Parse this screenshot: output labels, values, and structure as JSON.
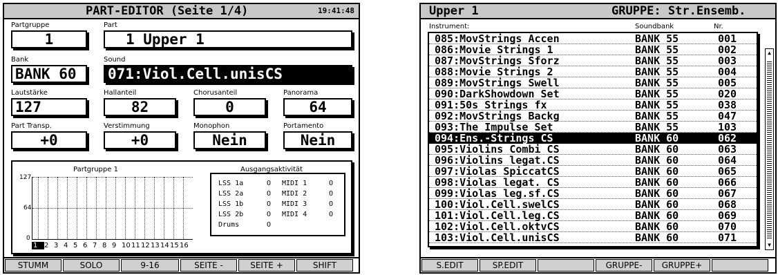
{
  "left": {
    "title": "PART-EDITOR (Seite 1/4)",
    "clock": "19:41:48",
    "partgruppe": {
      "label": "Partgruppe",
      "value": "1"
    },
    "part": {
      "label": "Part",
      "value": "1  Upper 1"
    },
    "bank": {
      "label": "Bank",
      "value": "BANK 60"
    },
    "sound": {
      "label": "Sound",
      "value": "071:Viol.Cell.unisCS"
    },
    "lautstaerke": {
      "label": "Lautstärke",
      "value": "127"
    },
    "hallanteil": {
      "label": "Hallanteil",
      "value": "82"
    },
    "chorusanteil": {
      "label": "Chorusanteil",
      "value": "0"
    },
    "panorama": {
      "label": "Panorama",
      "value": "64"
    },
    "part_transp": {
      "label": "Part Transp.",
      "value": "+0"
    },
    "verstimmung": {
      "label": "Verstimmung",
      "value": "+0"
    },
    "monophon": {
      "label": "Monophon",
      "value": "Nein"
    },
    "portamento": {
      "label": "Portamento",
      "value": "Nein"
    },
    "graph": {
      "title": "Partgruppe 1",
      "y_labels": [
        "127",
        "64",
        "0"
      ],
      "parts": [
        "1",
        "2",
        "3",
        "4",
        "5",
        "6",
        "7",
        "8",
        "9",
        "10",
        "11",
        "12",
        "13",
        "14",
        "15",
        "16"
      ],
      "selected_part": "1"
    },
    "ausgang": {
      "title": "Ausgangsaktivität",
      "rows": [
        {
          "a": "LSS 1a",
          "ao": "O",
          "b": "MIDI 1",
          "bo": "O"
        },
        {
          "a": "LSS 2a",
          "ao": "O",
          "b": "MIDI 2",
          "bo": "O"
        },
        {
          "a": "LSS 1b",
          "ao": "O",
          "b": "MIDI 3",
          "bo": "O"
        },
        {
          "a": "LSS 2b",
          "ao": "O",
          "b": "MIDI 4",
          "bo": "O"
        },
        {
          "a": "Drums",
          "ao": "O",
          "b": "",
          "bo": ""
        }
      ]
    },
    "softkeys": [
      "STUMM",
      "SOLO",
      "9-16",
      "SEITE -",
      "SEITE +",
      "SHIFT"
    ]
  },
  "right": {
    "title_left": "Upper 1",
    "title_right": "GRUPPE: Str.Ensemb.",
    "col_instrument": "Instrument:",
    "col_soundbank": "Soundbank",
    "col_nr": "Nr.",
    "rows": [
      {
        "name": "085:MovStrings Accen",
        "bank": "BANK 55",
        "nr": "001"
      },
      {
        "name": "086:Movie Strings 1",
        "bank": "BANK 55",
        "nr": "002"
      },
      {
        "name": "087:MovStrings Sforz",
        "bank": "BANK 55",
        "nr": "003"
      },
      {
        "name": "088:Movie Strings 2",
        "bank": "BANK 55",
        "nr": "004"
      },
      {
        "name": "089:MovStrings Swell",
        "bank": "BANK 55",
        "nr": "005"
      },
      {
        "name": "090:DarkShowdown Set",
        "bank": "BANK 55",
        "nr": "020"
      },
      {
        "name": "091:50s Strings  fx",
        "bank": "BANK 55",
        "nr": "038"
      },
      {
        "name": "092:MovStrings Backg",
        "bank": "BANK 55",
        "nr": "047"
      },
      {
        "name": "093:The Impulse Set",
        "bank": "BANK 55",
        "nr": "103"
      },
      {
        "name": "094:Ens.-Strings  CS",
        "bank": "BANK 60",
        "nr": "062"
      },
      {
        "name": "095:Violins Combi CS",
        "bank": "BANK 60",
        "nr": "063"
      },
      {
        "name": "096:Violins legat.CS",
        "bank": "BANK 60",
        "nr": "064"
      },
      {
        "name": "097:Violas SpiccatCS",
        "bank": "BANK 60",
        "nr": "065"
      },
      {
        "name": "098:Violas legat. CS",
        "bank": "BANK 60",
        "nr": "066"
      },
      {
        "name": "099:Violas leg.sf.CS",
        "bank": "BANK 60",
        "nr": "067"
      },
      {
        "name": "100:Viol.Cell.swelCS",
        "bank": "BANK 60",
        "nr": "068"
      },
      {
        "name": "101:Viol.Cell.leg.CS",
        "bank": "BANK 60",
        "nr": "069"
      },
      {
        "name": "102:Viol.Cell.oktvCS",
        "bank": "BANK 60",
        "nr": "070"
      },
      {
        "name": "103:Viol.Cell.unisCS",
        "bank": "BANK 60",
        "nr": "071"
      }
    ],
    "selected_index": 9,
    "softkeys": [
      "S.EDIT",
      "SP.EDIT",
      "",
      "GRUPPE-",
      "GRUPPE+",
      ""
    ]
  }
}
